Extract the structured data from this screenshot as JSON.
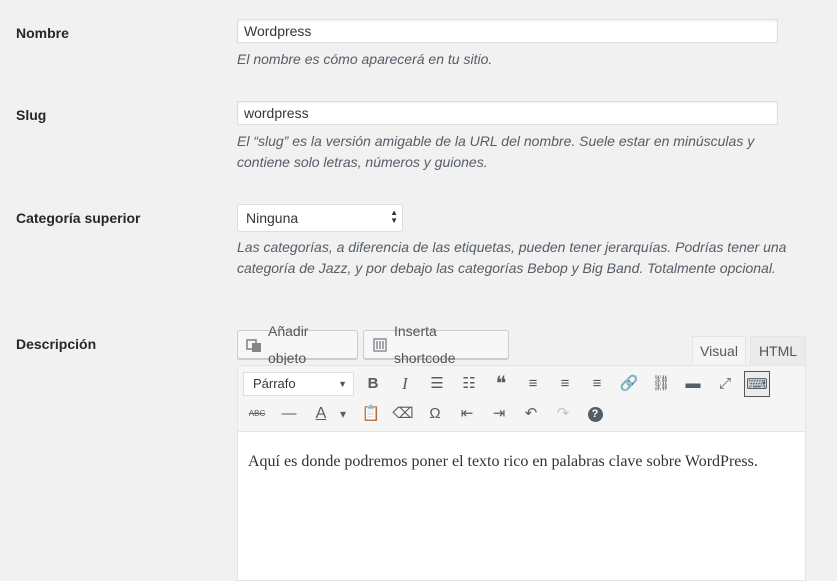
{
  "fields": {
    "name": {
      "label": "Nombre",
      "value": "Wordpress",
      "description": "El nombre es cómo aparecerá en tu sitio."
    },
    "slug": {
      "label": "Slug",
      "value": "wordpress",
      "description": "El “slug” es la versión amigable de la URL del nombre. Suele estar en minúsculas y contiene solo letras, números y guiones."
    },
    "parent": {
      "label": "Categoría superior",
      "selected": "Ninguna",
      "description": "Las categorías, a diferencia de las etiquetas, pueden tener jerarquías. Podrías tener una categoría de Jazz, y por debajo las categorías Bebop y Big Band. Totalmente opcional."
    },
    "description": {
      "label": "Descripción"
    }
  },
  "editor": {
    "add_media_label": "Añadir objeto",
    "insert_shortcode_label": "Inserta shortcode",
    "tabs": {
      "visual": "Visual",
      "html": "HTML"
    },
    "format_select": "Párrafo",
    "toolbar_row1": [
      {
        "name": "bold",
        "glyph": "B"
      },
      {
        "name": "italic",
        "glyph": "I"
      },
      {
        "name": "bullet-list",
        "glyph": "☰"
      },
      {
        "name": "numbered-list",
        "glyph": "☷"
      },
      {
        "name": "blockquote",
        "glyph": "❝"
      },
      {
        "name": "align-left",
        "glyph": "≡"
      },
      {
        "name": "align-center",
        "glyph": "≡"
      },
      {
        "name": "align-right",
        "glyph": "≡"
      },
      {
        "name": "link",
        "glyph": "🔗"
      },
      {
        "name": "unlink",
        "glyph": "⛓"
      },
      {
        "name": "read-more",
        "glyph": "▬"
      },
      {
        "name": "fullscreen",
        "glyph": "⤢"
      },
      {
        "name": "toolbar-toggle",
        "glyph": "⌨"
      }
    ],
    "toolbar_row2": [
      {
        "name": "strikethrough",
        "glyph": "ABC"
      },
      {
        "name": "horizontal-line",
        "glyph": "—"
      },
      {
        "name": "text-color",
        "glyph": "A"
      },
      {
        "name": "text-color-dropdown",
        "glyph": "▾"
      },
      {
        "name": "paste-text",
        "glyph": "📋"
      },
      {
        "name": "clear-formatting",
        "glyph": "⌫"
      },
      {
        "name": "special-character",
        "glyph": "Ω"
      },
      {
        "name": "outdent",
        "glyph": "⇤"
      },
      {
        "name": "indent",
        "glyph": "⇥"
      },
      {
        "name": "undo",
        "glyph": "↶"
      },
      {
        "name": "redo",
        "glyph": "↷"
      },
      {
        "name": "help",
        "glyph": "?"
      }
    ],
    "content": "Aquí es donde podremos poner el texto rico en palabras clave sobre WordPress."
  }
}
